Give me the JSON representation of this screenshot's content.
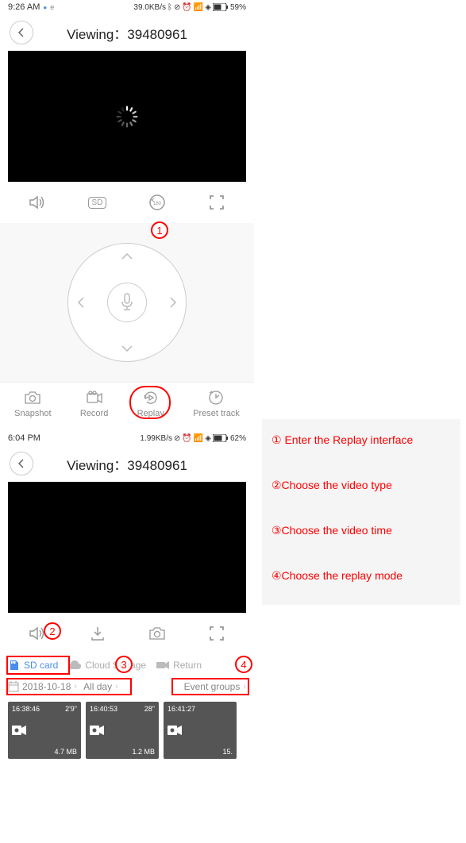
{
  "screen1": {
    "status": {
      "time": "9:26 AM",
      "speed": "39.0KB/s",
      "battery": "59%"
    },
    "header": {
      "title": "Viewing：39480961"
    },
    "controls": {
      "sd": "SD"
    },
    "tabs": {
      "snapshot": "Snapshot",
      "record": "Record",
      "replay": "Replay",
      "preset": "Preset track"
    }
  },
  "screen2": {
    "status": {
      "time": "6:04 PM",
      "speed": "1.99KB/s",
      "battery": "62%"
    },
    "header": {
      "title": "Viewing：39480961"
    },
    "storage": {
      "sdcard": "SD card",
      "cloud": "Cloud Storage",
      "return": "Return"
    },
    "date": {
      "day": "2018-10-18",
      "allday": "All day",
      "event": "Event groups"
    },
    "clips": [
      {
        "time": "16:38:46",
        "dur": "2'9\"",
        "size": "4.7 MB"
      },
      {
        "time": "16:40:53",
        "dur": "28\"",
        "size": "1.2 MB"
      },
      {
        "time": "16:41:27",
        "dur": "",
        "size": "15."
      }
    ]
  },
  "badges": {
    "b1": "1",
    "b2": "2",
    "b3": "3",
    "b4": "4"
  },
  "instructions": {
    "i1": "① Enter the Replay interface",
    "i2": "②Choose the video type",
    "i3": "③Choose the video time",
    "i4": "④Choose the replay mode"
  }
}
